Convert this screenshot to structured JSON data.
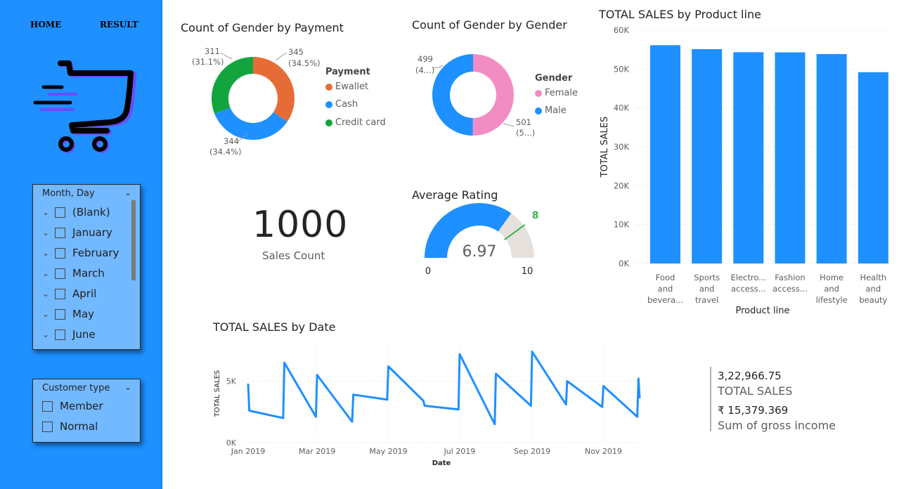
{
  "nav": {
    "home": "HOME",
    "result": "RESULT"
  },
  "month_slicer": {
    "title": "Month, Day",
    "items": [
      "(Blank)",
      "January",
      "February",
      "March",
      "April",
      "May",
      "June"
    ]
  },
  "customer_slicer": {
    "title": "Customer type",
    "items": [
      "Member",
      "Normal"
    ]
  },
  "kpi": {
    "sales_count_value": "1000",
    "sales_count_label": "Sales Count"
  },
  "summary": {
    "total_sales_value": "3,22,966.75",
    "total_sales_label": "TOTAL SALES",
    "gross_income_value": "₹ 15,379.369",
    "gross_income_label": "Sum of gross income"
  },
  "colors": {
    "blue": "#1e90ff",
    "orange": "#e66c37",
    "green": "#12a53f",
    "pink": "#f28dc4",
    "gauge_track": "#e6e1dc",
    "target": "#3bb54a"
  },
  "chart_data": [
    {
      "type": "pie",
      "title": "Count of Gender by Payment",
      "legend_title": "Payment",
      "categories": [
        "Ewallet",
        "Cash",
        "Credit card"
      ],
      "values": [
        345,
        344,
        311
      ],
      "colors": [
        "#e66c37",
        "#1e90ff",
        "#12a53f"
      ],
      "labels": [
        {
          "value": "345",
          "percent": "(34.5%)"
        },
        {
          "value": "344",
          "percent": "(34.4%)"
        },
        {
          "value": "311",
          "percent": "(31.1%)"
        }
      ]
    },
    {
      "type": "pie",
      "title": "Count of Gender by Gender",
      "legend_title": "Gender",
      "categories": [
        "Female",
        "Male"
      ],
      "values": [
        501,
        499
      ],
      "colors": [
        "#f28dc4",
        "#1e90ff"
      ],
      "labels": [
        {
          "value": "501",
          "percent": "(5...)"
        },
        {
          "value": "499",
          "percent": "(4...)"
        }
      ]
    },
    {
      "type": "bar",
      "title": "TOTAL SALES by Product line",
      "xlabel": "Product line",
      "ylabel": "TOTAL SALES",
      "categories": [
        [
          "Food",
          "and",
          "bevera..."
        ],
        [
          "Sports",
          "and",
          "travel"
        ],
        [
          "Electro...",
          "access..."
        ],
        [
          "Fashion",
          "access..."
        ],
        [
          "Home",
          "and",
          "lifestyle"
        ],
        [
          "Health",
          "and",
          "beauty"
        ]
      ],
      "values": [
        56145,
        55123,
        54338,
        54306,
        53862,
        49194
      ],
      "ylim": [
        0,
        60000
      ],
      "yticks": [
        0,
        10000,
        20000,
        30000,
        40000,
        50000,
        60000
      ],
      "ytick_labels": [
        "0K",
        "10K",
        "20K",
        "30K",
        "40K",
        "50K",
        "60K"
      ],
      "color": "#1e90ff",
      "grid": true
    },
    {
      "type": "gauge",
      "title": "Average Rating",
      "value": 6.97,
      "value_label": "6.97",
      "min": 0,
      "max": 10,
      "min_label": "0",
      "max_label": "10",
      "target": 8,
      "target_label": "8"
    },
    {
      "type": "line",
      "title": "TOTAL SALES by Date",
      "xlabel": "Date",
      "ylabel": "TOTAL SALES",
      "x": [
        "2019-01-01",
        "2019-01-02",
        "2019-01-31",
        "2019-02-01",
        "2019-02-28",
        "2019-03-01",
        "2019-03-31",
        "2019-04-01",
        "2019-04-30",
        "2019-05-01",
        "2019-05-31",
        "2019-06-01",
        "2019-06-30",
        "2019-07-01",
        "2019-07-31",
        "2019-08-01",
        "2019-08-31",
        "2019-09-01",
        "2019-09-30",
        "2019-10-01",
        "2019-10-31",
        "2019-11-01",
        "2019-11-30",
        "2019-12-01",
        "2019-12-02"
      ],
      "y": [
        4800,
        2600,
        2000,
        6500,
        2100,
        5500,
        1700,
        3900,
        3500,
        6200,
        3400,
        3000,
        2700,
        7200,
        1500,
        5600,
        3000,
        7400,
        3100,
        5000,
        2900,
        4600,
        2100,
        5200,
        3600
      ],
      "ylim": [
        0,
        8000
      ],
      "yticks": [
        0,
        5000
      ],
      "ytick_labels": [
        "0K",
        "5K"
      ],
      "xticks": [
        "2019-01-01",
        "2019-03-01",
        "2019-05-01",
        "2019-07-01",
        "2019-09-01",
        "2019-11-01"
      ],
      "xtick_labels": [
        "Jan 2019",
        "Mar 2019",
        "May 2019",
        "Jul 2019",
        "Sep 2019",
        "Nov 2019"
      ],
      "color": "#1e90ff",
      "grid": true
    }
  ]
}
